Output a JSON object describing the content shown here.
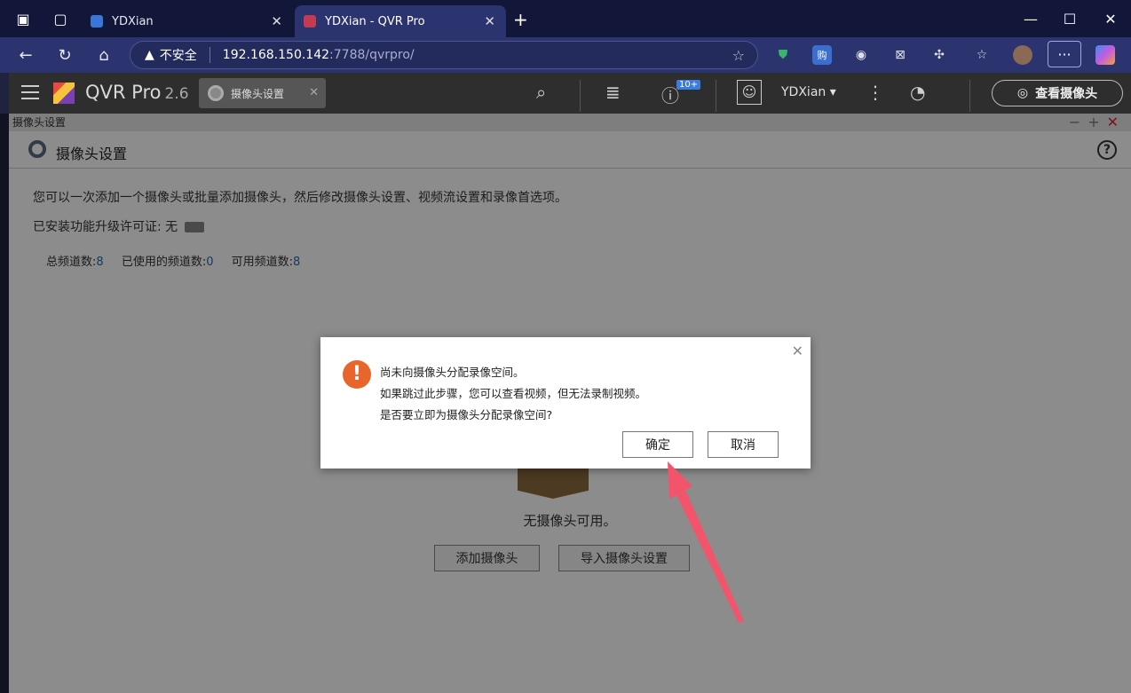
{
  "browser": {
    "tabs": [
      {
        "title": "YDXian"
      },
      {
        "title": "YDXian - QVR Pro"
      }
    ],
    "address": {
      "security_label": "不安全",
      "host": "192.168.150.142",
      "path": ":7788/qvrpro/"
    }
  },
  "app": {
    "brand": "QVR Pro",
    "version": "2.6",
    "open_tab": "摄像头设置",
    "notification_badge": "10+",
    "user": "YDXian",
    "view_cameras": "查看摄像头"
  },
  "window": {
    "title": "摄像头设置"
  },
  "pane": {
    "title": "摄像头设置",
    "description": "您可以一次添加一个摄像头或批量添加摄像头，然后修改摄像头设置、视频流设置和录像首选项。",
    "license": "已安装功能升级许可证: 无",
    "channels": {
      "total_label": "总频道数:",
      "total": "8",
      "used_label": "已使用的频道数:",
      "used": "0",
      "available_label": "可用频道数:",
      "available": "8"
    },
    "empty_text": "无摄像头可用。",
    "add_camera": "添加摄像头",
    "import_settings": "导入摄像头设置"
  },
  "dialog": {
    "line1": "尚未向摄像头分配录像空间。",
    "line2": "如果跳过此步骤，您可以查看视频，但无法录制视频。",
    "line3": "是否要立即为摄像头分配录像空间?",
    "confirm": "确定",
    "cancel": "取消"
  },
  "colors": {
    "browser_bg": "#12173a",
    "toolbar_bg": "#2c3470",
    "app_header": "#2e2e2e",
    "warning_icon": "#e8652b",
    "arrow": "#f2556b"
  }
}
